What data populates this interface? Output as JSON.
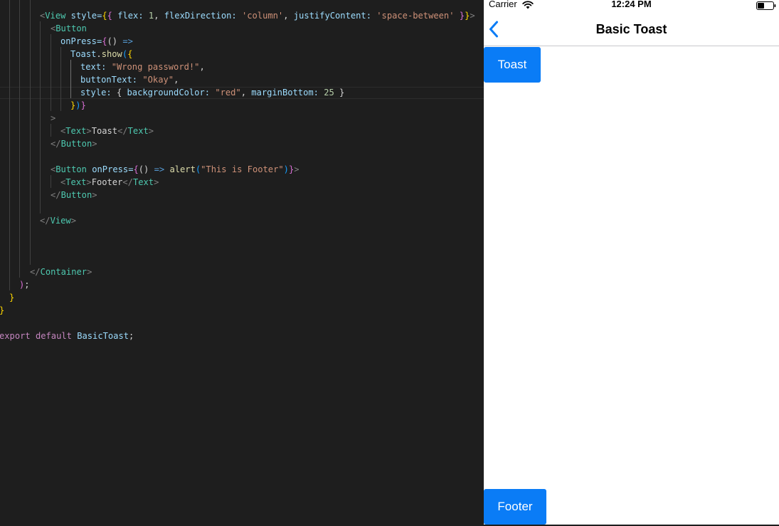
{
  "editor": {
    "view_open": {
      "open": "<",
      "tag": "View",
      "attr": " style=",
      "b1": "{",
      "b2": "{",
      "k1": " flex: ",
      "v1": "1",
      "c1": ", ",
      "k2": "flexDirection: ",
      "v2": "'column'",
      "c2": ", ",
      "k3": "justifyContent: ",
      "v3": "'space-between'",
      "b3": " }",
      "b4": "}",
      "close": ">"
    },
    "button_open": {
      "open": "<",
      "tag": "Button"
    },
    "onpress_line": {
      "attr": "onPress=",
      "b1": "{",
      "args": "() ",
      "arrow": "=>"
    },
    "toast_show_line": {
      "obj": "Toast",
      "dot": ".",
      "fn": "show",
      "b1": "(",
      "b2": "{"
    },
    "text_prop": {
      "key": "text: ",
      "value": "\"Wrong password!\"",
      "comma": ","
    },
    "buttontext_prop": {
      "key": "buttonText: ",
      "value": "\"Okay\"",
      "comma": ","
    },
    "style_prop": {
      "key": "style: ",
      "b1": "{ ",
      "k1": "backgroundColor: ",
      "v1": "\"red\"",
      "c1": ", ",
      "k2": "marginBottom: ",
      "v2": "25",
      "b2": " }"
    },
    "close_show_line": {
      "b1": "}",
      "b2": ")",
      "b3": "}"
    },
    "gt_line": ">",
    "toast_text_line": {
      "o1": "<",
      "t1": "Text",
      "g1": ">",
      "content": "Toast",
      "o2": "</",
      "t2": "Text",
      "g2": ">"
    },
    "button_close_1": {
      "open": "</",
      "tag": "Button",
      "close": ">"
    },
    "footer_button_open": {
      "open": "<",
      "tag": "Button",
      "attr": " onPress=",
      "b1": "{",
      "args": "() ",
      "arrow": "=>",
      "sp": " ",
      "fn": "alert",
      "b2": "(",
      "str": "\"This is Footer\"",
      "b3": ")",
      "b4": "}",
      "close": ">"
    },
    "footer_text_line": {
      "o1": "<",
      "t1": "Text",
      "g1": ">",
      "content": "Footer",
      "o2": "</",
      "t2": "Text",
      "g2": ">"
    },
    "button_close_2": {
      "open": "</",
      "tag": "Button",
      "close": ">"
    },
    "view_close": {
      "open": "</",
      "tag": "View",
      "close": ">"
    },
    "container_close": {
      "open": "</",
      "tag": "Container",
      "close": ">"
    },
    "paren_close": {
      "paren": ")",
      "semi": ";"
    },
    "brace_close_1": "}",
    "brace_close_2": "}",
    "export_line": {
      "kw": "export default ",
      "name": "BasicToast",
      "semi": ";"
    }
  },
  "simulator": {
    "status_bar": {
      "carrier": "Carrier",
      "time": "12:24 PM"
    },
    "nav": {
      "title": "Basic Toast"
    },
    "buttons": {
      "toast_label": "Toast",
      "footer_label": "Footer"
    },
    "colors": {
      "button_bg": "#0a7cf6",
      "back_tint": "#0a7cf6"
    }
  }
}
